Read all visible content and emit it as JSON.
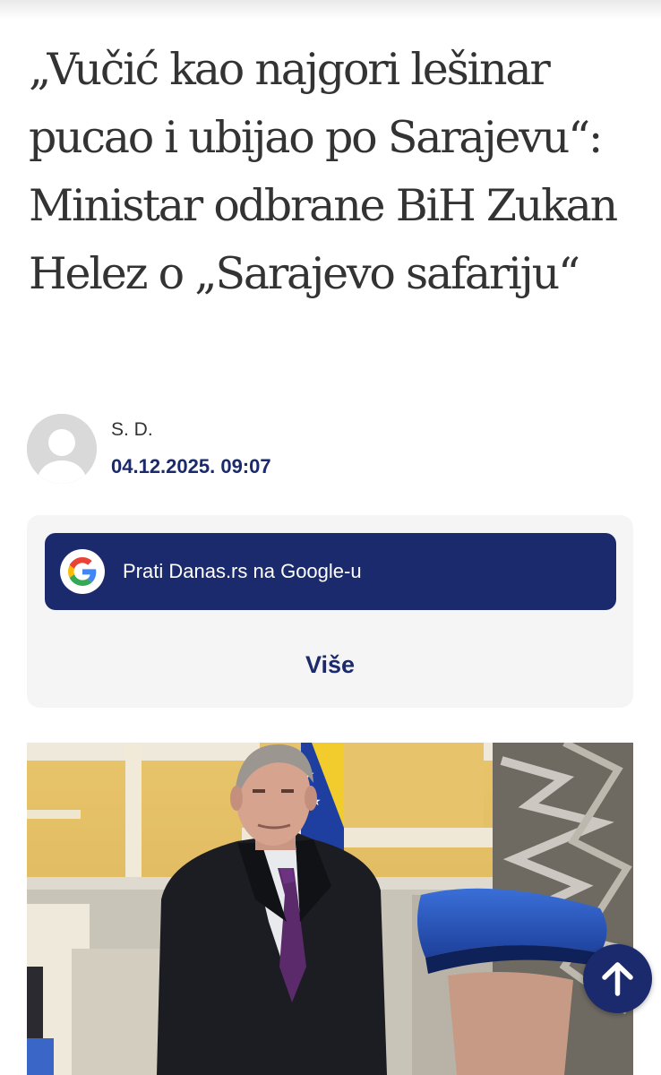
{
  "article": {
    "headline": "„Vučić kao najgori lešinar pucao i ubijao po Sarajevu“: Ministar odbrane BiH Zukan Helez o „Sarajevo safariju“",
    "author": "S. D.",
    "date": "04.12.2025. 09:07"
  },
  "follow": {
    "google_label": "Prati Danas.rs na Google-u",
    "more_label": "Više"
  },
  "icons": {
    "avatar": "user-placeholder-icon",
    "google": "google-g-icon",
    "scroll_top": "arrow-up-icon"
  },
  "colors": {
    "brand_navy": "#1a2a6c",
    "headline_text": "#333333",
    "card_background": "#f5f5f5"
  }
}
